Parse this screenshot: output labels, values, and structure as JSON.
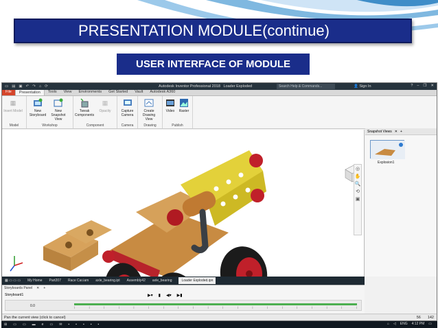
{
  "slide": {
    "title": "PRESENTATION MODULE(continue)",
    "subtitle": "USER INTERFACE OF MODULE"
  },
  "app": {
    "window_title": "Autodesk Inventor Professional 2018",
    "doc_title": "Loader Exploded",
    "search_placeholder": "Search Help & Commands...",
    "signin_label": "Sign In",
    "colors": {
      "titlebar": "#26333d",
      "file_tab": "#d5452b",
      "timeline": "#4caf50"
    }
  },
  "ribbon_tabs": [
    "File",
    "Presentation",
    "Tools",
    "View",
    "Environments",
    "Get Started",
    "Vault",
    "Autodesk A360"
  ],
  "ribbon_groups": [
    {
      "label": "Model",
      "buttons": [
        {
          "label": "Insert Model",
          "icon": "insert-model-icon",
          "disabled": true
        }
      ]
    },
    {
      "label": "Workshop",
      "buttons": [
        {
          "label": "New Storyboard",
          "icon": "new-storyboard-icon"
        },
        {
          "label": "New Snapshot View",
          "icon": "new-snapshot-icon"
        }
      ]
    },
    {
      "label": "Component",
      "buttons": [
        {
          "label": "Tweak Components",
          "icon": "tweak-components-icon"
        },
        {
          "label": "Opacity",
          "icon": "opacity-icon",
          "disabled": true
        }
      ]
    },
    {
      "label": "Camera",
      "buttons": [
        {
          "label": "Capture Camera",
          "icon": "capture-camera-icon"
        }
      ]
    },
    {
      "label": "Drawing",
      "buttons": [
        {
          "label": "Create Drawing View",
          "icon": "create-drawing-view-icon"
        }
      ]
    },
    {
      "label": "Publish",
      "buttons": [
        {
          "label": "Video",
          "icon": "video-icon"
        },
        {
          "label": "Raster",
          "icon": "raster-icon"
        }
      ]
    }
  ],
  "snapshot_panel": {
    "header": "Snapshot Views",
    "items": [
      "Explosion1"
    ]
  },
  "document_tabs": [
    "My Home",
    "Part207",
    "Race Car.iam",
    "axle_bearing.ipt",
    "Assembly42",
    "axle_bearing",
    "Loader Exploded.ipn"
  ],
  "storyboard": {
    "panel_title": "Storyboards Panel",
    "name": "Storyboard1",
    "time": "0.0"
  },
  "status_bar": {
    "message": "Pan the current view (click to cancel)",
    "num1": "56",
    "num2": "142"
  },
  "taskbar": {
    "lang": "ENG",
    "time": "4:12 PM"
  }
}
